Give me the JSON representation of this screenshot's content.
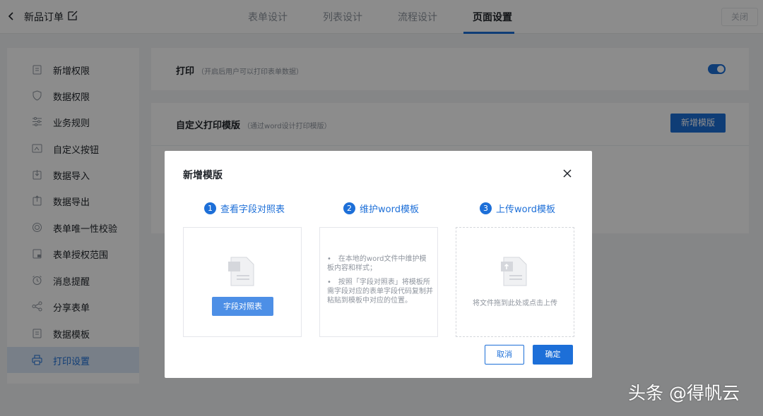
{
  "header": {
    "title": "新品订单",
    "tabs": [
      {
        "label": "表单设计"
      },
      {
        "label": "列表设计"
      },
      {
        "label": "流程设计"
      },
      {
        "label": "页面设置"
      }
    ],
    "close_label": "关闭",
    "active_tab_color": "#1d6fd8"
  },
  "sidebar": {
    "items": [
      {
        "label": "新增权限",
        "icon": "clipboard-icon"
      },
      {
        "label": "数据权限",
        "icon": "shield-icon"
      },
      {
        "label": "业务规则",
        "icon": "sliders-icon"
      },
      {
        "label": "自定义按钮",
        "icon": "button-icon"
      },
      {
        "label": "数据导入",
        "icon": "import-icon"
      },
      {
        "label": "数据导出",
        "icon": "export-icon"
      },
      {
        "label": "表单唯一性校验",
        "icon": "check-badge-icon"
      },
      {
        "label": "表单授权范围",
        "icon": "clipboard-lock-icon"
      },
      {
        "label": "消息提醒",
        "icon": "alarm-clock-icon"
      },
      {
        "label": "分享表单",
        "icon": "share-icon"
      },
      {
        "label": "数据模板",
        "icon": "clipboard-icon"
      },
      {
        "label": "打印设置",
        "icon": "printer-icon",
        "active": true
      }
    ]
  },
  "main": {
    "print": {
      "title": "打印",
      "hint": "（开启后用户可以打印表单数据）",
      "enabled": true
    },
    "custom_template": {
      "title": "自定义打印模版",
      "hint": "（通过word设计打印模版）",
      "add_button": "新增模版"
    }
  },
  "modal": {
    "title": "新增模版",
    "steps": [
      {
        "num": "1",
        "label": "查看字段对照表"
      },
      {
        "num": "2",
        "label": "维护word模板"
      },
      {
        "num": "3",
        "label": "上传word模板"
      }
    ],
    "panel1_button": "字段对照表",
    "panel2_bullets": [
      "•　在本地的word文件中维护模板内容和样式；",
      "•　按照「字段对照表」将模板所需字段对应的表单字段代码复制并粘贴到模板中对应的位置。"
    ],
    "panel3_hint": "将文件拖到此处或点击上传",
    "cancel_label": "取消",
    "confirm_label": "确定"
  },
  "watermark": "头条 @得帆云"
}
